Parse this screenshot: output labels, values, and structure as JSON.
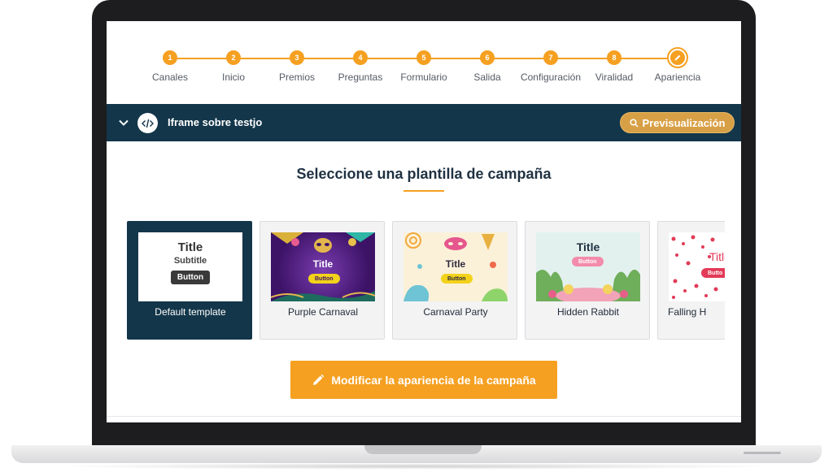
{
  "stepper": {
    "accent_color": "#f5a021",
    "steps": [
      {
        "number": "1",
        "label": "Canales"
      },
      {
        "number": "2",
        "label": "Inicio"
      },
      {
        "number": "3",
        "label": "Premios"
      },
      {
        "number": "4",
        "label": "Preguntas"
      },
      {
        "number": "5",
        "label": "Formulario"
      },
      {
        "number": "6",
        "label": "Salida"
      },
      {
        "number": "7",
        "label": "Configuración"
      },
      {
        "number": "8",
        "label": "Viralidad"
      },
      {
        "number": "",
        "label": "Apariencia",
        "icon": "pencil-icon",
        "active": true
      }
    ]
  },
  "bar": {
    "background": "#13364a",
    "toggle_icon": "chevron-down-icon",
    "code_icon": "code-icon",
    "title": "Iframe sobre testjo",
    "preview_label": "Previsualización",
    "preview_icon": "search-icon"
  },
  "section": {
    "heading": "Seleccione una plantilla de campaña"
  },
  "templates": [
    {
      "label": "Default template",
      "selected": true,
      "thumb": {
        "title": "Title",
        "subtitle": "Subtitle",
        "button": "Button"
      }
    },
    {
      "label": "Purple Carnaval",
      "thumb": {
        "title": "Title",
        "button": "Button"
      }
    },
    {
      "label": "Carnaval Party",
      "thumb": {
        "title": "Title",
        "button": "Button"
      }
    },
    {
      "label": "Hidden Rabbit",
      "thumb": {
        "title": "Title",
        "button": "Button"
      }
    },
    {
      "label": "Falling H",
      "thumb": {
        "title": "Title",
        "button": "Butto"
      }
    }
  ],
  "cta": {
    "label": "Modificar la apariencia de la campaña",
    "icon": "pencil-icon"
  }
}
